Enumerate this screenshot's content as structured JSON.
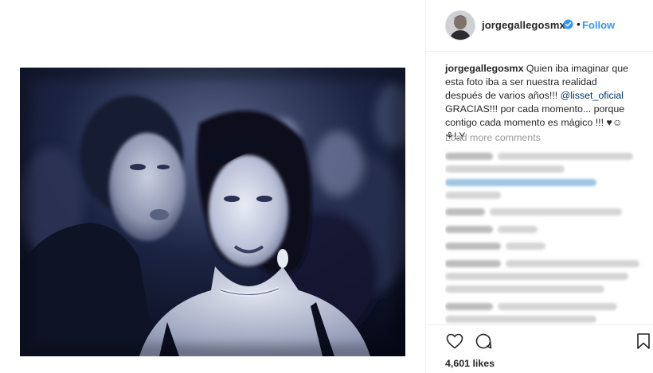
{
  "post": {
    "username": "jorgegallegosmx",
    "follow_label": "Follow",
    "separator": "•",
    "verified": true,
    "caption": {
      "username": "jorgegallegosmx",
      "text_before": " Quien iba imaginar que esta foto iba a ser nuestra realidad después de varios años!!! ",
      "mention": "@lisset_oficial",
      "text_after": " GRACIAS!!! por cada momento... porque contigo cada momento es mágico !!! ♥☺⚘LY"
    },
    "load_more_label": "Load more comments",
    "likes_label": "4,601 likes",
    "photo_description_icon": "couple-photo"
  },
  "colors": {
    "accent": "#3897f0",
    "mention": "#003569",
    "muted": "#999999",
    "border": "#efefef"
  },
  "icons": {
    "like": "heart-icon",
    "comment": "speech-bubble-icon",
    "save": "bookmark-icon",
    "verified": "verified-badge-icon"
  }
}
